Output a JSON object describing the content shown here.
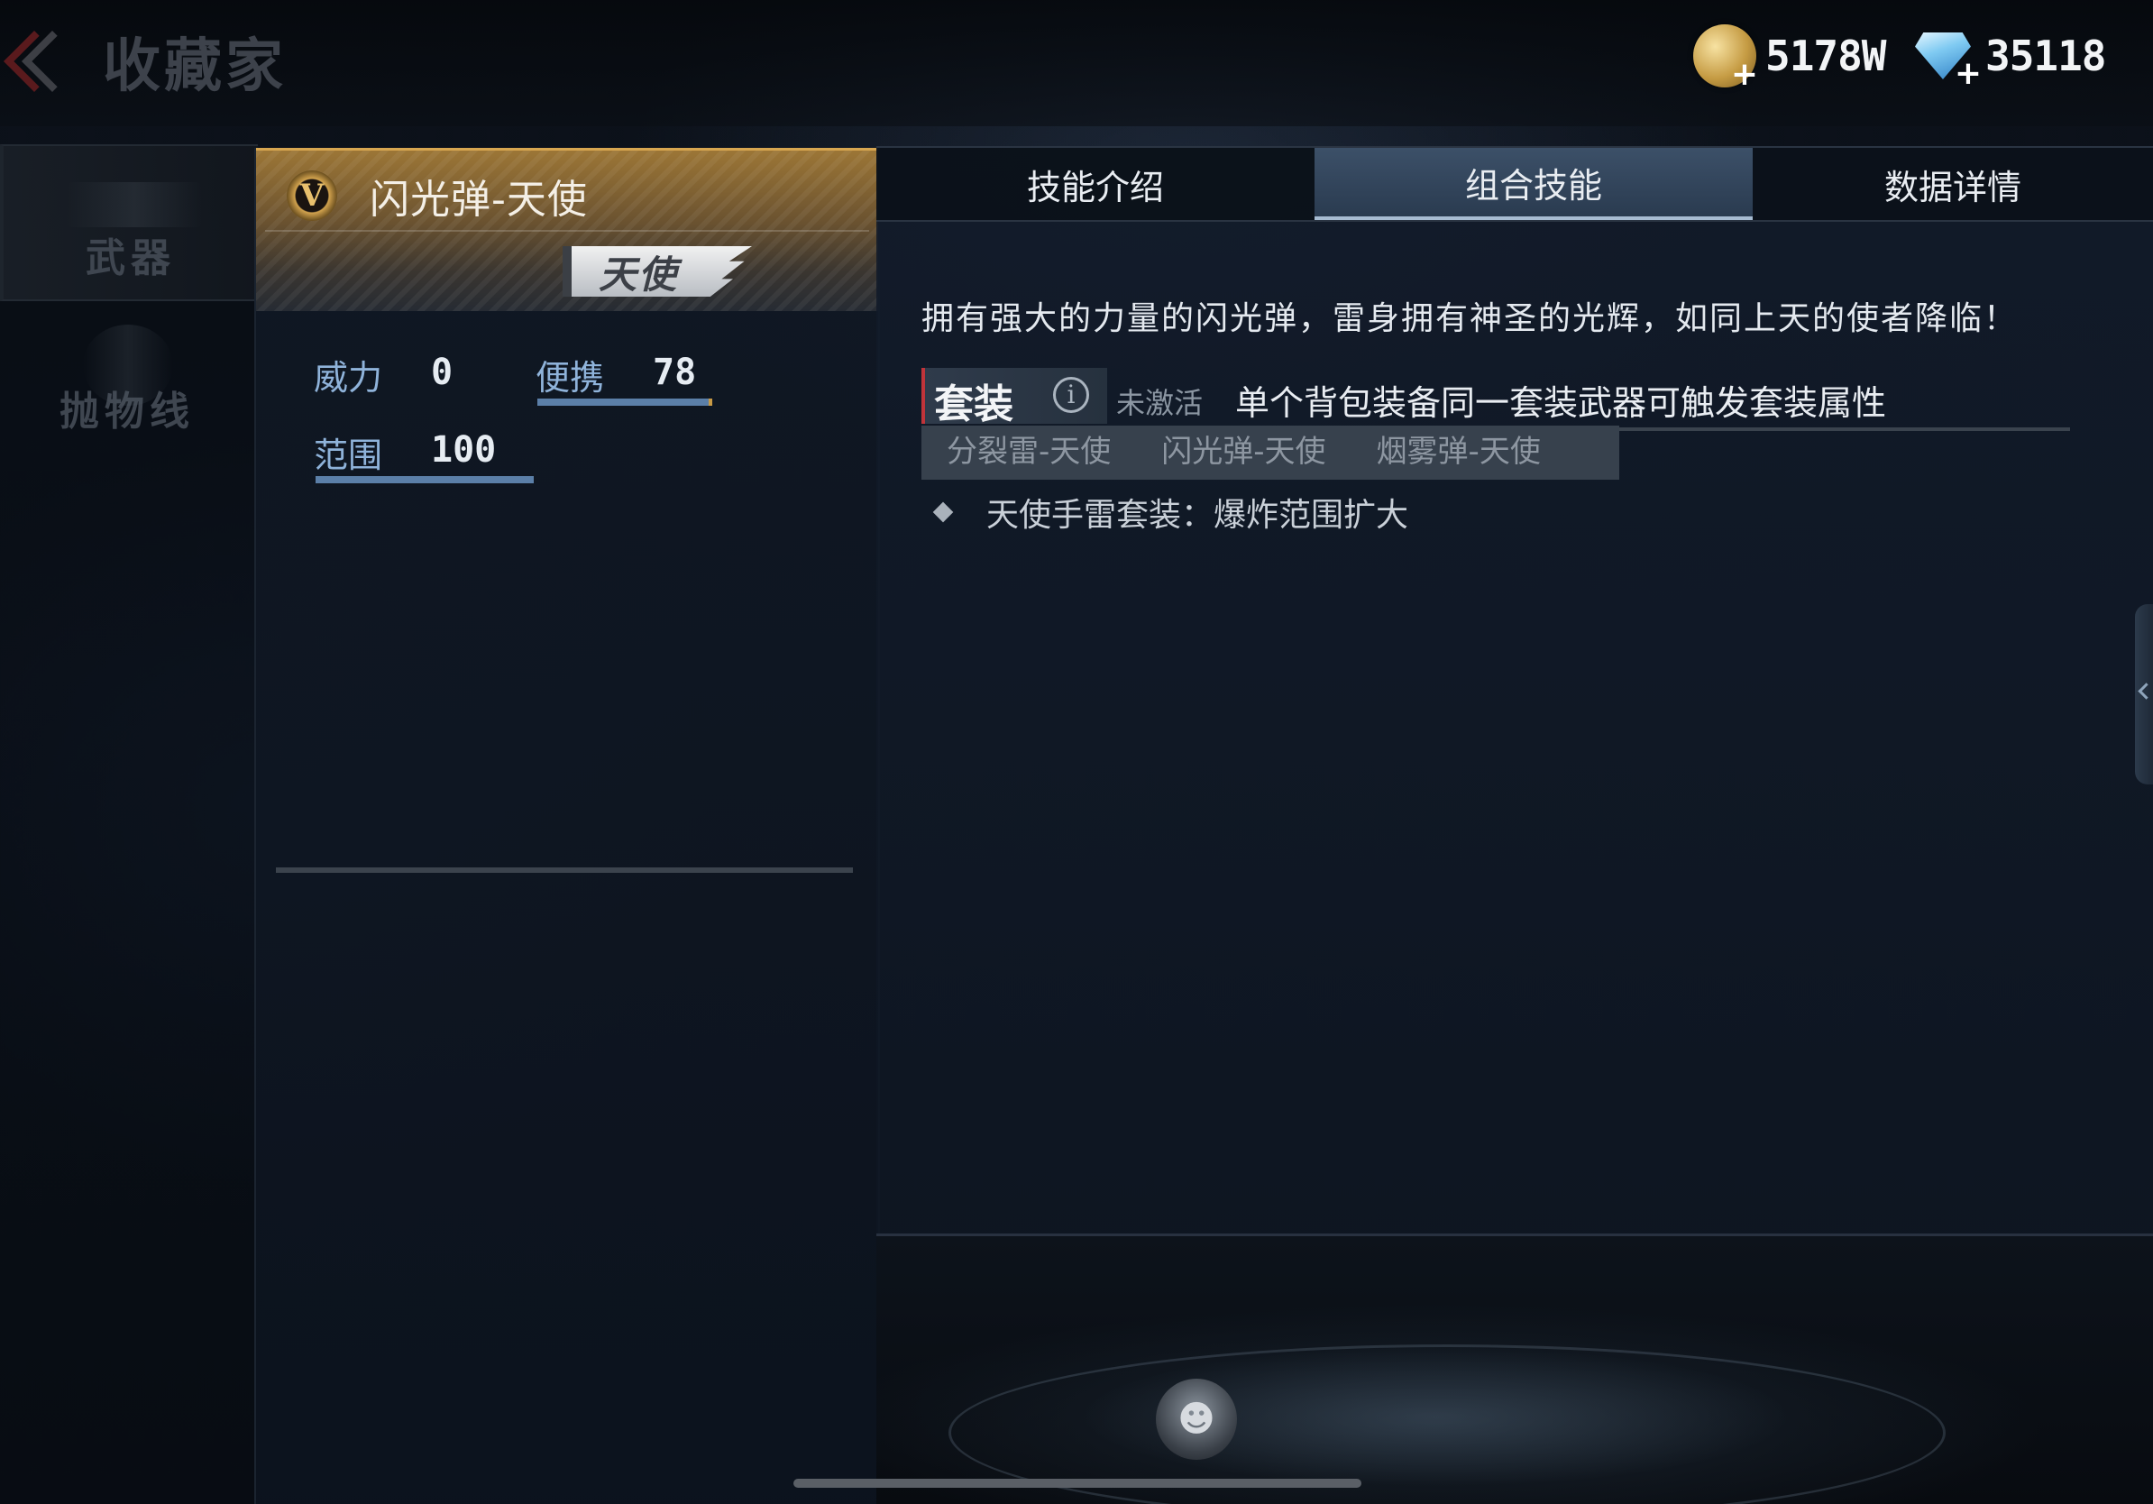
{
  "header": {
    "title": "收藏家",
    "gold_value": "5178W",
    "diamond_value": "35118"
  },
  "sidebar": {
    "items": [
      {
        "label": "武器",
        "selected": true
      },
      {
        "label": "抛物线",
        "selected": false
      }
    ]
  },
  "weapon": {
    "tier_letter": "V",
    "name": "闪光弹-天使",
    "series_badge": "天使",
    "stats": {
      "power": {
        "label": "威力",
        "value": "0"
      },
      "portable": {
        "label": "便携",
        "value": "78"
      },
      "range": {
        "label": "范围",
        "value": "100"
      }
    }
  },
  "tabs": [
    {
      "label": "技能介绍",
      "active": false
    },
    {
      "label": "组合技能",
      "active": true
    },
    {
      "label": "数据详情",
      "active": false
    }
  ],
  "skill": {
    "description": "拥有强大的力量的闪光弹，雷身拥有神圣的光辉，如同上天的使者降临！",
    "set_label": "套装",
    "set_status": "未激活",
    "set_hint": "单个背包装备同一套装武器可触发套装属性",
    "set_items": [
      "分裂雷-天使",
      "闪光弹-天使",
      "烟雾弹-天使"
    ],
    "set_bonus": "天使手雷套装：爆炸范围扩大"
  },
  "colors": {
    "accent_gold": "#d7a650",
    "tab_active": "#3c5068",
    "stat_label": "#8fb3da",
    "inactive_red": "#c0343a"
  },
  "icons": {
    "back": "chevron-left-icon",
    "gold": "gold-coin-icon",
    "diamond": "diamond-icon",
    "tier": "tier-v-icon",
    "info": "info-icon",
    "emblem": "gorilla-emblem-icon"
  }
}
